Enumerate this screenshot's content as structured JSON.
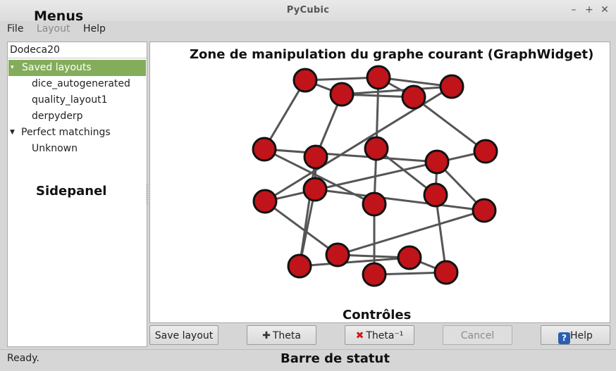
{
  "window": {
    "title": "PyCubic"
  },
  "annotations": {
    "menus": "Menus",
    "graph_zone": "Zone de manipulation du graphe courant (GraphWidget)",
    "sidepanel": "Sidepanel",
    "controls": "Contrôles",
    "statusbar": "Barre de statut"
  },
  "menubar": {
    "file": "File",
    "layout": "Layout",
    "help": "Help"
  },
  "sidepanel": {
    "graph_name": "Dodeca20",
    "saved_layouts_label": "Saved layouts",
    "saved_layouts": [
      "dice_autogenerated",
      "quality_layout1",
      "derpyderp"
    ],
    "perfect_matchings_label": "Perfect matchings",
    "perfect_matchings": [
      "Unknown"
    ]
  },
  "controls": {
    "save_layout": "Save layout",
    "theta": "Theta",
    "theta_inv": "Theta⁻¹",
    "cancel": "Cancel",
    "help": "Help"
  },
  "status": {
    "text": "Ready."
  },
  "colors": {
    "node_fill": "#c0141a",
    "node_stroke": "#111111",
    "edge": "#555555",
    "selection": "#84ad5b"
  },
  "graph": {
    "nodes": [
      "n1",
      "n2",
      "n3",
      "n4",
      "n5",
      "n6",
      "n7",
      "n8",
      "n9",
      "n10",
      "n11",
      "n12",
      "n13",
      "n14",
      "n15",
      "n16",
      "n17",
      "n18",
      "n19",
      "n20"
    ],
    "edges": [
      [
        "n1",
        "n2"
      ],
      [
        "n2",
        "n3"
      ],
      [
        "n3",
        "n4"
      ],
      [
        "n4",
        "n5"
      ],
      [
        "n1",
        "n4"
      ],
      [
        "n2",
        "n5"
      ],
      [
        "n1",
        "n6"
      ],
      [
        "n5",
        "n7"
      ],
      [
        "n2",
        "n9"
      ],
      [
        "n3",
        "n11"
      ],
      [
        "n4",
        "n8"
      ],
      [
        "n6",
        "n10"
      ],
      [
        "n7",
        "n11"
      ],
      [
        "n6",
        "n13"
      ],
      [
        "n8",
        "n16"
      ],
      [
        "n9",
        "n13"
      ],
      [
        "n9",
        "n14"
      ],
      [
        "n10",
        "n14"
      ],
      [
        "n10",
        "n15"
      ],
      [
        "n8",
        "n12"
      ],
      [
        "n11",
        "n17"
      ],
      [
        "n12",
        "n15"
      ],
      [
        "n12",
        "n16"
      ],
      [
        "n13",
        "n18"
      ],
      [
        "n16",
        "n19"
      ],
      [
        "n14",
        "n20"
      ],
      [
        "n15",
        "n17"
      ],
      [
        "n17",
        "n19"
      ],
      [
        "n18",
        "n20"
      ],
      [
        "n19",
        "n20"
      ]
    ]
  }
}
